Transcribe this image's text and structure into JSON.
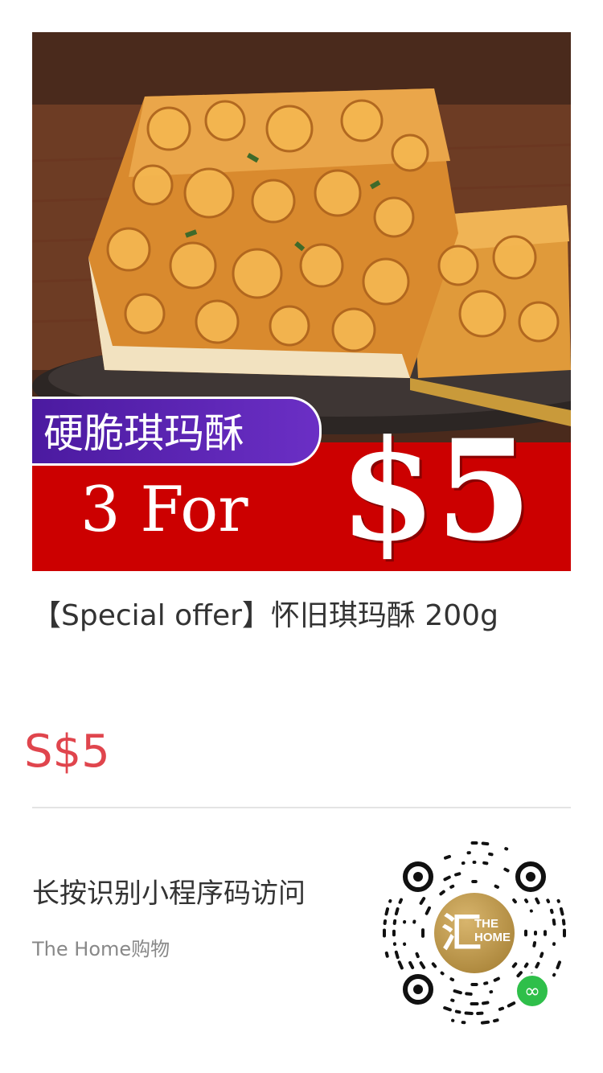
{
  "product": {
    "banner_label": "硬脆琪玛酥",
    "banner_offer": "3 For",
    "banner_price": "$5",
    "title": "【Special offer】怀旧琪玛酥  200g",
    "price": "S$5"
  },
  "share": {
    "scan_hint": "长按识别小程序码访问",
    "store_name": "The Home购物",
    "qr_logo_text": "THE HOME",
    "qr_logo_mark": "汇"
  },
  "icons": {
    "miniprogram_badge": "miniprogram-icon",
    "qr_code": "qr-code-icon"
  },
  "colors": {
    "price": "#e0454d",
    "banner_red": "#cc0000",
    "banner_purple": "#5b24b3",
    "miniprogram_green": "#2fbf4a"
  }
}
